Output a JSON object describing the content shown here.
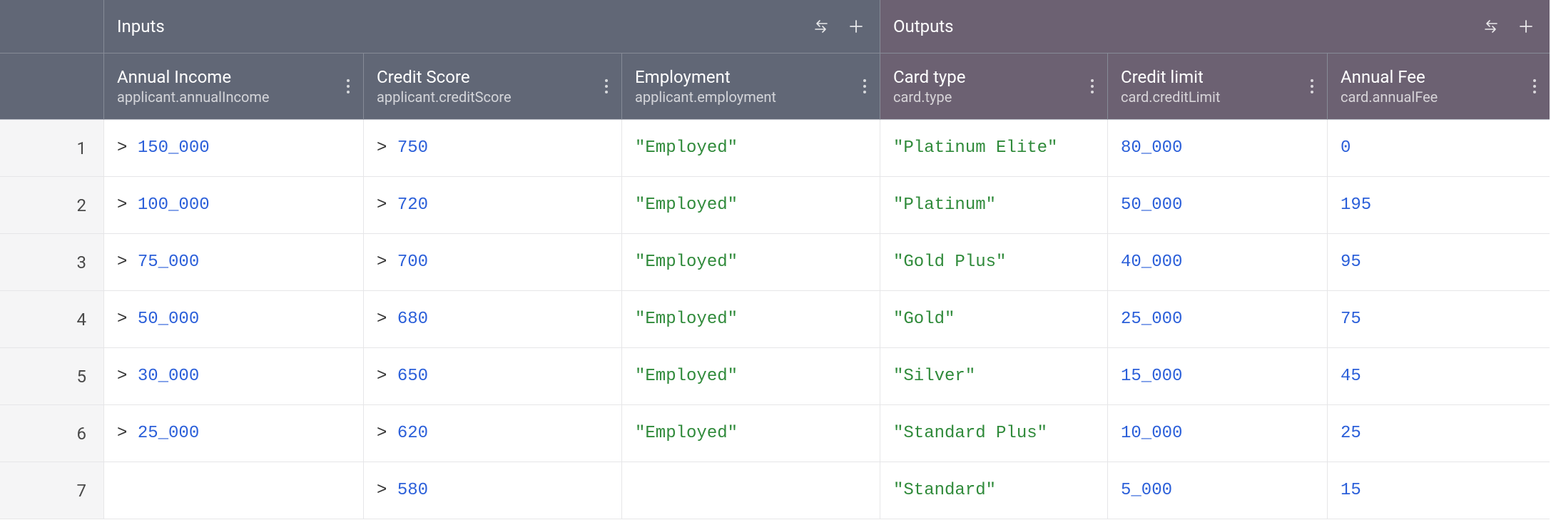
{
  "sections": {
    "inputs_label": "Inputs",
    "outputs_label": "Outputs"
  },
  "columns": {
    "inputs": [
      {
        "title": "Annual Income",
        "path": "applicant.annualIncome"
      },
      {
        "title": "Credit Score",
        "path": "applicant.creditScore"
      },
      {
        "title": "Employment",
        "path": "applicant.employment"
      }
    ],
    "outputs": [
      {
        "title": "Card type",
        "path": "card.type"
      },
      {
        "title": "Credit limit",
        "path": "card.creditLimit"
      },
      {
        "title": "Annual Fee",
        "path": "card.annualFee"
      }
    ]
  },
  "rows": [
    {
      "num": "1",
      "income_op": "> ",
      "income_val": "150_000",
      "score_op": "> ",
      "score_val": "750",
      "employment": "\"Employed\"",
      "card_type": "\"Platinum Elite\"",
      "credit_limit": "80_000",
      "annual_fee": "0"
    },
    {
      "num": "2",
      "income_op": "> ",
      "income_val": "100_000",
      "score_op": "> ",
      "score_val": "720",
      "employment": "\"Employed\"",
      "card_type": "\"Platinum\"",
      "credit_limit": "50_000",
      "annual_fee": "195"
    },
    {
      "num": "3",
      "income_op": "> ",
      "income_val": "75_000",
      "score_op": "> ",
      "score_val": "700",
      "employment": "\"Employed\"",
      "card_type": "\"Gold Plus\"",
      "credit_limit": "40_000",
      "annual_fee": "95"
    },
    {
      "num": "4",
      "income_op": "> ",
      "income_val": "50_000",
      "score_op": "> ",
      "score_val": "680",
      "employment": "\"Employed\"",
      "card_type": "\"Gold\"",
      "credit_limit": "25_000",
      "annual_fee": "75"
    },
    {
      "num": "5",
      "income_op": "> ",
      "income_val": "30_000",
      "score_op": "> ",
      "score_val": "650",
      "employment": "\"Employed\"",
      "card_type": "\"Silver\"",
      "credit_limit": "15_000",
      "annual_fee": "45"
    },
    {
      "num": "6",
      "income_op": "> ",
      "income_val": "25_000",
      "score_op": "> ",
      "score_val": "620",
      "employment": "\"Employed\"",
      "card_type": "\"Standard Plus\"",
      "credit_limit": "10_000",
      "annual_fee": "25"
    },
    {
      "num": "7",
      "income_op": "",
      "income_val": "",
      "score_op": "> ",
      "score_val": "580",
      "employment": "",
      "card_type": "\"Standard\"",
      "credit_limit": "5_000",
      "annual_fee": "15"
    }
  ]
}
